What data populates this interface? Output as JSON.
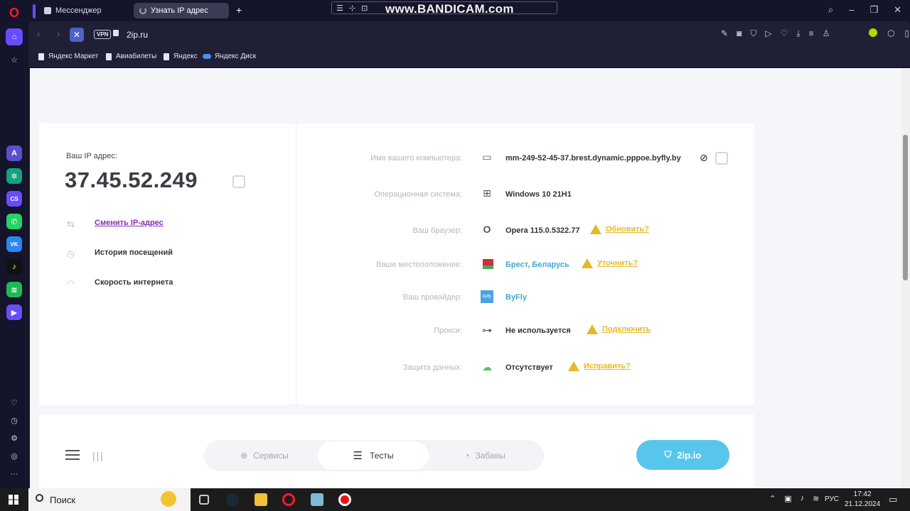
{
  "browser": {
    "tabs": [
      {
        "label": "Мессенджер"
      },
      {
        "label": "Узнать IP адрес"
      }
    ],
    "new_tab": "+",
    "watermark": "www.BANDICAM.com",
    "url": "2ip.ru",
    "vpn": "VPN",
    "bookmarks": [
      "Яндекс Маркет",
      "Авиабилеты",
      "Яндекс",
      "Яндекс Диск"
    ]
  },
  "sidebar": {
    "apps": [
      {
        "name": "aria",
        "color": "#5a4fcf",
        "glyph": "A"
      },
      {
        "name": "chatgpt",
        "color": "#10a37f",
        "glyph": "✲"
      },
      {
        "name": "cs",
        "color": "#6a4cff",
        "glyph": "CS"
      },
      {
        "name": "whatsapp",
        "color": "#25d366",
        "glyph": "✆"
      },
      {
        "name": "vk",
        "color": "#2787f5",
        "glyph": "VK"
      },
      {
        "name": "tiktok",
        "color": "#111111",
        "glyph": "♪"
      },
      {
        "name": "spotify",
        "color": "#1db954",
        "glyph": "≋"
      },
      {
        "name": "player",
        "color": "#6a4cff",
        "glyph": "▶"
      }
    ]
  },
  "ip_panel": {
    "label": "Ваш IP адрес:",
    "value": "37.45.52.249",
    "links": {
      "change_ip": "Сменить IP-адрес",
      "history": "История посещений",
      "speed": "Скорость интернета"
    }
  },
  "info_rows": [
    {
      "label": "Имя вашего компьютера:",
      "value": "mm-249-52-45-37.brest.dynamic.pppoe.byfly.by",
      "action": ""
    },
    {
      "label": "Операционная система:",
      "value": "Windows 10 21H1",
      "action": ""
    },
    {
      "label": "Ваш браузер:",
      "value": "Opera 115.0.5322.77",
      "action": "Обновить?"
    },
    {
      "label": "Ваше местоположение:",
      "value": "Брест, Беларусь",
      "action": "Уточнить?"
    },
    {
      "label": "Ваш провайдер:",
      "value": "ByFly",
      "action": ""
    },
    {
      "label": "Прокси:",
      "value": "Не используется",
      "action": "Подключить"
    },
    {
      "label": "Защита данных:",
      "value": "Отсутствует",
      "action": "Исправить?"
    }
  ],
  "bottom_nav": {
    "tabs": [
      {
        "label": "Сервисы"
      },
      {
        "label": "Тесты"
      },
      {
        "label": "Забавы"
      }
    ],
    "cta": "2ip.io"
  },
  "taskbar": {
    "search": "Поиск",
    "lang": "РУС",
    "time": "17:42",
    "date": "21.12.2024"
  },
  "colors": {
    "accent_purple": "#8b2bb9",
    "cta_blue": "#58c6ec",
    "warn_yellow": "#e5b928",
    "opera_red": "#ff1b2d"
  }
}
